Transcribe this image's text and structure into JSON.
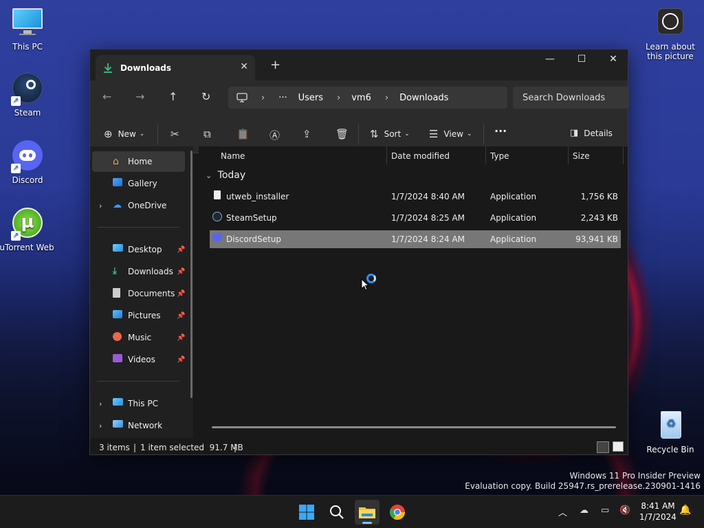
{
  "desktop": {
    "icons": [
      {
        "label": "This PC"
      },
      {
        "label": "Steam"
      },
      {
        "label": "Discord"
      },
      {
        "label": "uTorrent Web"
      },
      {
        "label": "Learn about this picture"
      },
      {
        "label": "Recycle Bin"
      }
    ],
    "watermark": {
      "line1": "Windows 11 Pro Insider Preview",
      "line2": "Evaluation copy. Build 25947.rs_prerelease.230901-1416"
    }
  },
  "window": {
    "tab_title": "Downloads",
    "tab_close": "✕",
    "new_tab": "+",
    "controls": {
      "minimize": "—",
      "maximize": "☐",
      "close": "✕"
    }
  },
  "address": {
    "more": "···",
    "crumbs": [
      "Users",
      "vm6",
      "Downloads"
    ],
    "separator": "›",
    "search_placeholder": "Search Downloads"
  },
  "commands": {
    "new_label": "New",
    "sort_label": "Sort",
    "view_label": "View",
    "more": "···",
    "details_label": "Details"
  },
  "sidebar": {
    "items": [
      {
        "label": "Home"
      },
      {
        "label": "Gallery"
      },
      {
        "label": "OneDrive"
      },
      {
        "label": "Desktop"
      },
      {
        "label": "Downloads"
      },
      {
        "label": "Documents"
      },
      {
        "label": "Pictures"
      },
      {
        "label": "Music"
      },
      {
        "label": "Videos"
      },
      {
        "label": "This PC"
      },
      {
        "label": "Network"
      }
    ]
  },
  "columns": {
    "name": "Name",
    "date": "Date modified",
    "type": "Type",
    "size": "Size"
  },
  "group_label": "Today",
  "files": [
    {
      "name": "utweb_installer",
      "date": "1/7/2024 8:40 AM",
      "type": "Application",
      "size": "1,756 KB"
    },
    {
      "name": "SteamSetup",
      "date": "1/7/2024 8:25 AM",
      "type": "Application",
      "size": "2,243 KB"
    },
    {
      "name": "DiscordSetup",
      "date": "1/7/2024 8:24 AM",
      "type": "Application",
      "size": "93,941 KB"
    }
  ],
  "status": {
    "count": "3 items",
    "selection": "1 item selected  91.7 MB"
  },
  "taskbar": {
    "time": "8:41 AM",
    "date": "1/7/2024"
  }
}
